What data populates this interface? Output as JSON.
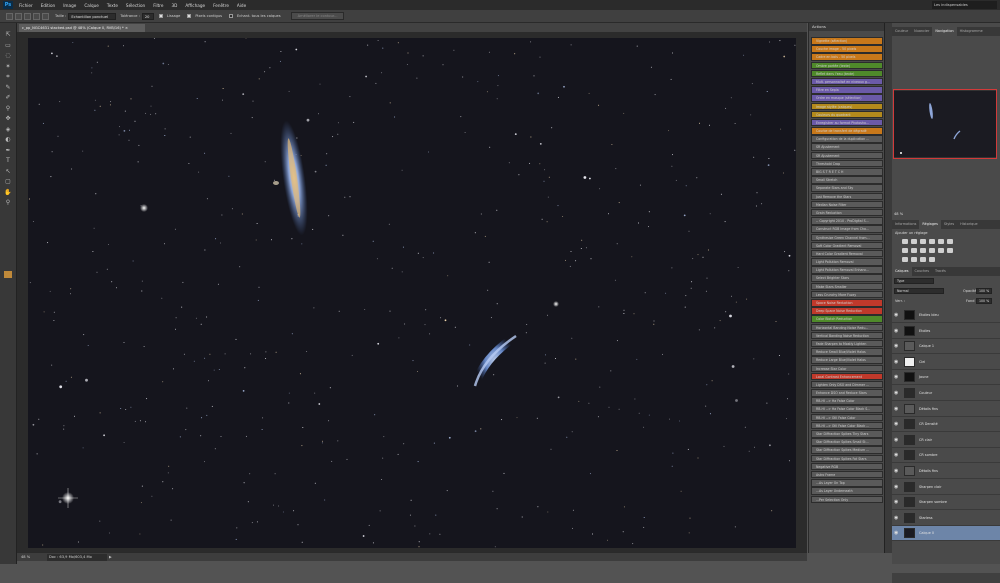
{
  "app": {
    "logo": "Ps"
  },
  "menu": [
    "Fichier",
    "Edition",
    "Image",
    "Calque",
    "Texte",
    "Sélection",
    "Filtre",
    "3D",
    "Affichage",
    "Fenêtre",
    "Aide"
  ],
  "workspace": "Les indispensables",
  "options": {
    "sample_label": "Taille :",
    "sample_value": "Echantillon ponctuel",
    "tolerance_label": "Tolérance :",
    "tolerance_value": "20",
    "antialias_label": "Lissage",
    "contiguous_label": "Pixels contigus",
    "sample_all_label": "Echant. tous les calques",
    "refine_button": "Améliorer le contour..."
  },
  "document": {
    "tab_title": "c_pp_NGC4631 stacked.psd @ 48% (Calque 0, RVB/16) *  ×"
  },
  "status": {
    "zoom": "48 %",
    "doc": "Doc : 63,9 Mo/603,4 Mo",
    "arrow": "▶"
  },
  "actions_panel": {
    "title": "Actions",
    "items": [
      {
        "label": "Vignette (sélection)",
        "color": "#c8781a"
      },
      {
        "label": "Couche image - 50 pixels",
        "color": "#c8781a"
      },
      {
        "label": "Cadre en bois - 50 pixels",
        "color": "#c8781a"
      },
      {
        "label": "Ombre portée (texte)",
        "color": "#4f8a2a"
      },
      {
        "label": "Reflet dans l'eau (texte)",
        "color": "#4f8a2a"
      },
      {
        "label": "Mult. personnalisé en niveaux g...",
        "color": "#6b5aa8"
      },
      {
        "label": "Filtre en Sepia",
        "color": "#6b5aa8"
      },
      {
        "label": "Ordre en masque (sélection)",
        "color": "#6b5aa8"
      },
      {
        "label": "Image stylée (calques)",
        "color": "#b38a1c"
      },
      {
        "label": "Couleurs du quadrant",
        "color": "#b38a1c"
      },
      {
        "label": "Enregistrer au format Photosho...",
        "color": "#6b5aa8"
      },
      {
        "label": "Courbe de transfert de dégradé",
        "color": "#c8781a"
      },
      {
        "label": "Configuration de la duplication ...",
        "color": "#5a5a5a"
      },
      {
        "label": "SR Ajustement",
        "color": "#5a5a5a"
      },
      {
        "label": "SR Ajustement",
        "color": "#5a5a5a"
      },
      {
        "label": "Threshold Crop",
        "color": "#5a5a5a"
      },
      {
        "label": "BIG S T R E T C H",
        "color": "#5a5a5a"
      },
      {
        "label": "Small Stretch",
        "color": "#5a5a5a"
      },
      {
        "label": "Separate Stars and Sky",
        "color": "#5a5a5a"
      },
      {
        "label": "Just Remove the Stars",
        "color": "#5a5a5a"
      },
      {
        "label": "Median Noise Filter",
        "color": "#5a5a5a"
      },
      {
        "label": "Grain Reduction",
        "color": "#5a5a5a"
      },
      {
        "label": "-- Copyright 2010 - ProDigital S...",
        "color": "#5a5a5a"
      },
      {
        "label": "Construct RGB Image from Cha...",
        "color": "#5a5a5a"
      },
      {
        "label": "Synthesize Green Channel from...",
        "color": "#5a5a5a"
      },
      {
        "label": "Soft Color Gradient Removal",
        "color": "#5a5a5a"
      },
      {
        "label": "Hard Color Gradient Removal",
        "color": "#5a5a5a"
      },
      {
        "label": "Light Pollution Removal",
        "color": "#5a5a5a"
      },
      {
        "label": "Light Pollution Removal Enhanc...",
        "color": "#5a5a5a"
      },
      {
        "label": "Select Brighter Stars",
        "color": "#5a5a5a"
      },
      {
        "label": "Make Stars Smaller",
        "color": "#5a5a5a"
      },
      {
        "label": "Less Crunchy More Fuzzy",
        "color": "#5a5a5a"
      },
      {
        "label": "Space Noise Reduction",
        "color": "#c0392b"
      },
      {
        "label": "Deep Space Noise Reduction",
        "color": "#c0392b"
      },
      {
        "label": "Color Blotch Reduction",
        "color": "#4f8a2a"
      },
      {
        "label": "Horizontal Banding Noise Redu...",
        "color": "#5a5a5a"
      },
      {
        "label": "Vertical Banding Noise Reduction",
        "color": "#5a5a5a"
      },
      {
        "label": "Fade Sharpen to Mostly Lighten",
        "color": "#5a5a5a"
      },
      {
        "label": "Reduce Small Blue/Violet Halos",
        "color": "#5a5a5a"
      },
      {
        "label": "Reduce Large Blue/Violet Halos",
        "color": "#5a5a5a"
      },
      {
        "label": "Increase Star Color",
        "color": "#5a5a5a"
      },
      {
        "label": "Local Contrast Enhancement",
        "color": "#c0392b"
      },
      {
        "label": "Lighten Only DSO and Dimmer ...",
        "color": "#5a5a5a"
      },
      {
        "label": "Enhance DSO and Reduce Stars",
        "color": "#5a5a5a"
      },
      {
        "label": "RB-HI --> Ha False Color",
        "color": "#5a5a5a"
      },
      {
        "label": "RB-HI --> Ha False Color Black S...",
        "color": "#5a5a5a"
      },
      {
        "label": "RB-HI --> OIII False Color",
        "color": "#5a5a5a"
      },
      {
        "label": "RB-HI --> OIII False Color Black ...",
        "color": "#5a5a5a"
      },
      {
        "label": "Star Diffraction Spikes Tiny Stars",
        "color": "#5a5a5a"
      },
      {
        "label": "Star Diffraction Spikes Small St...",
        "color": "#5a5a5a"
      },
      {
        "label": "Star Diffraction Spikes Medium ...",
        "color": "#5a5a5a"
      },
      {
        "label": "Star Diffraction Spikes Fat Stars",
        "color": "#5a5a5a"
      },
      {
        "label": "Negative RGB",
        "color": "#5a5a5a"
      },
      {
        "label": "Astro Frame",
        "color": "#5a5a5a"
      },
      {
        "label": "...As Layer On Top",
        "color": "#5a5a5a"
      },
      {
        "label": "...As Layer Underneath",
        "color": "#5a5a5a"
      },
      {
        "label": "...Per Selection Only",
        "color": "#5a5a5a"
      }
    ]
  },
  "nav_panel": {
    "tabs": [
      "Couleur",
      "Nuancier",
      "Navigation",
      "Histogramme"
    ],
    "active": 2,
    "zoom": "48 %"
  },
  "adjust_panel": {
    "tabs": [
      "Informations",
      "Réglages",
      "Styles",
      "Historique"
    ],
    "active": 1,
    "title": "Ajouter un réglage"
  },
  "layers_panel": {
    "tabs": [
      "Calques",
      "Couches",
      "Tracés"
    ],
    "filter": "Type",
    "mode": "Normal",
    "opacity_label": "Opacité :",
    "opacity": "100 %",
    "lock_label": "Verr. :",
    "fill_label": "Fond :",
    "fill": "100 %",
    "layers": [
      {
        "name": "Etoiles bleu",
        "thumb": "#111111",
        "selected": false
      },
      {
        "name": "Etoiles",
        "thumb": "#111111",
        "selected": false
      },
      {
        "name": "Calque 1",
        "thumb": "#5a5a5a",
        "selected": false
      },
      {
        "name": "Ciel",
        "thumb": "#f0f0f0",
        "selected": false
      },
      {
        "name": "Jaune",
        "thumb": "#111111",
        "selected": false
      },
      {
        "name": "Couleur",
        "thumb": "#2a2a2a",
        "selected": false
      },
      {
        "name": "Détails fins",
        "thumb": "#5a5a5a",
        "selected": false
      },
      {
        "name": "CR Densité",
        "thumb": "#2a2a2a",
        "selected": false
      },
      {
        "name": "CR clair",
        "thumb": "#2a2a2a",
        "selected": false
      },
      {
        "name": "CR sombre",
        "thumb": "#2a2a2a",
        "selected": false
      },
      {
        "name": "Détails fins",
        "thumb": "#5a5a5a",
        "selected": false
      },
      {
        "name": "Sharpen clair",
        "thumb": "#2a2a2a",
        "selected": false
      },
      {
        "name": "Sharpen sombre",
        "thumb": "#2a2a2a",
        "selected": false
      },
      {
        "name": "Starless",
        "thumb": "#2a2a2a",
        "selected": false
      },
      {
        "name": "Calque 0",
        "thumb": "#1b1b22",
        "selected": true
      }
    ]
  }
}
